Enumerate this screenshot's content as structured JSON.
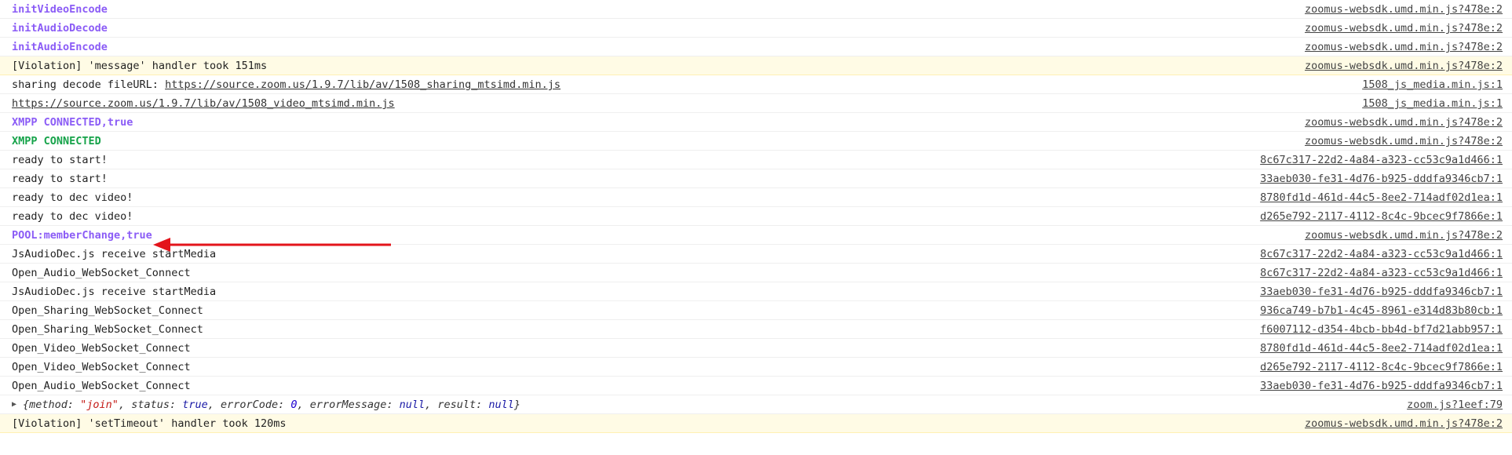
{
  "rows": [
    {
      "text": "initVideoEncode",
      "src": "zoomus-websdk.umd.min.js?478e:2"
    },
    {
      "text": "initAudioDecode",
      "src": "zoomus-websdk.umd.min.js?478e:2"
    },
    {
      "text": "initAudioEncode",
      "src": "zoomus-websdk.umd.min.js?478e:2"
    },
    {
      "text": "[Violation] 'message' handler took 151ms",
      "src": "zoomus-websdk.umd.min.js?478e:2"
    },
    {
      "prefix": "sharing decode fileURL: ",
      "link": "https://source.zoom.us/1.9.7/lib/av/1508_sharing_mtsimd.min.js",
      "src": "1508_js_media.min.js:1"
    },
    {
      "link": "https://source.zoom.us/1.9.7/lib/av/1508_video_mtsimd.min.js",
      "src": "1508_js_media.min.js:1"
    },
    {
      "text": "XMPP CONNECTED,true",
      "src": "zoomus-websdk.umd.min.js?478e:2"
    },
    {
      "text": "XMPP CONNECTED",
      "src": "zoomus-websdk.umd.min.js?478e:2"
    },
    {
      "text": "ready to start!",
      "src": "8c67c317-22d2-4a84-a323-cc53c9a1d466:1"
    },
    {
      "text": "ready to start!",
      "src": "33aeb030-fe31-4d76-b925-dddfa9346cb7:1"
    },
    {
      "text": "ready to dec video!",
      "src": "8780fd1d-461d-44c5-8ee2-714adf02d1ea:1"
    },
    {
      "text": "ready to dec video!",
      "src": "d265e792-2117-4112-8c4c-9bcec9f7866e:1"
    },
    {
      "text": "POOL:memberChange,true",
      "src": "zoomus-websdk.umd.min.js?478e:2"
    },
    {
      "text": "JsAudioDec.js receive startMedia",
      "src": "8c67c317-22d2-4a84-a323-cc53c9a1d466:1"
    },
    {
      "text": "Open_Audio_WebSocket_Connect",
      "src": "8c67c317-22d2-4a84-a323-cc53c9a1d466:1"
    },
    {
      "text": "JsAudioDec.js receive startMedia",
      "src": "33aeb030-fe31-4d76-b925-dddfa9346cb7:1"
    },
    {
      "text": "Open_Sharing_WebSocket_Connect",
      "src": "936ca749-b7b1-4c45-8961-e314d83b80cb:1"
    },
    {
      "text": "Open_Sharing_WebSocket_Connect",
      "src": "f6007112-d354-4bcb-bb4d-bf7d21abb957:1"
    },
    {
      "text": "Open_Video_WebSocket_Connect",
      "src": "8780fd1d-461d-44c5-8ee2-714adf02d1ea:1"
    },
    {
      "text": "Open_Video_WebSocket_Connect",
      "src": "d265e792-2117-4112-8c4c-9bcec9f7866e:1"
    },
    {
      "text": "Open_Audio_WebSocket_Connect",
      "src": "33aeb030-fe31-4d76-b925-dddfa9346cb7:1"
    },
    {
      "obj": {
        "p1": "{method: ",
        "method": "\"join\"",
        "p2": ", status: ",
        "status": "true",
        "p3": ", errorCode: ",
        "code": "0",
        "p4": ", errorMessage: ",
        "emsg": "null",
        "p5": ", result: ",
        "result": "null",
        "p6": "}"
      },
      "src": "zoom.js?1eef:79"
    },
    {
      "text": "[Violation] 'setTimeout' handler took 120ms",
      "src": "zoomus-websdk.umd.min.js?478e:2"
    }
  ],
  "icons": {
    "expand": "▶"
  },
  "colors": {
    "purple": "#8b5cf6",
    "green": "#16a34a",
    "warning_bg": "#fffbe5",
    "arrow": "#e3141b"
  }
}
